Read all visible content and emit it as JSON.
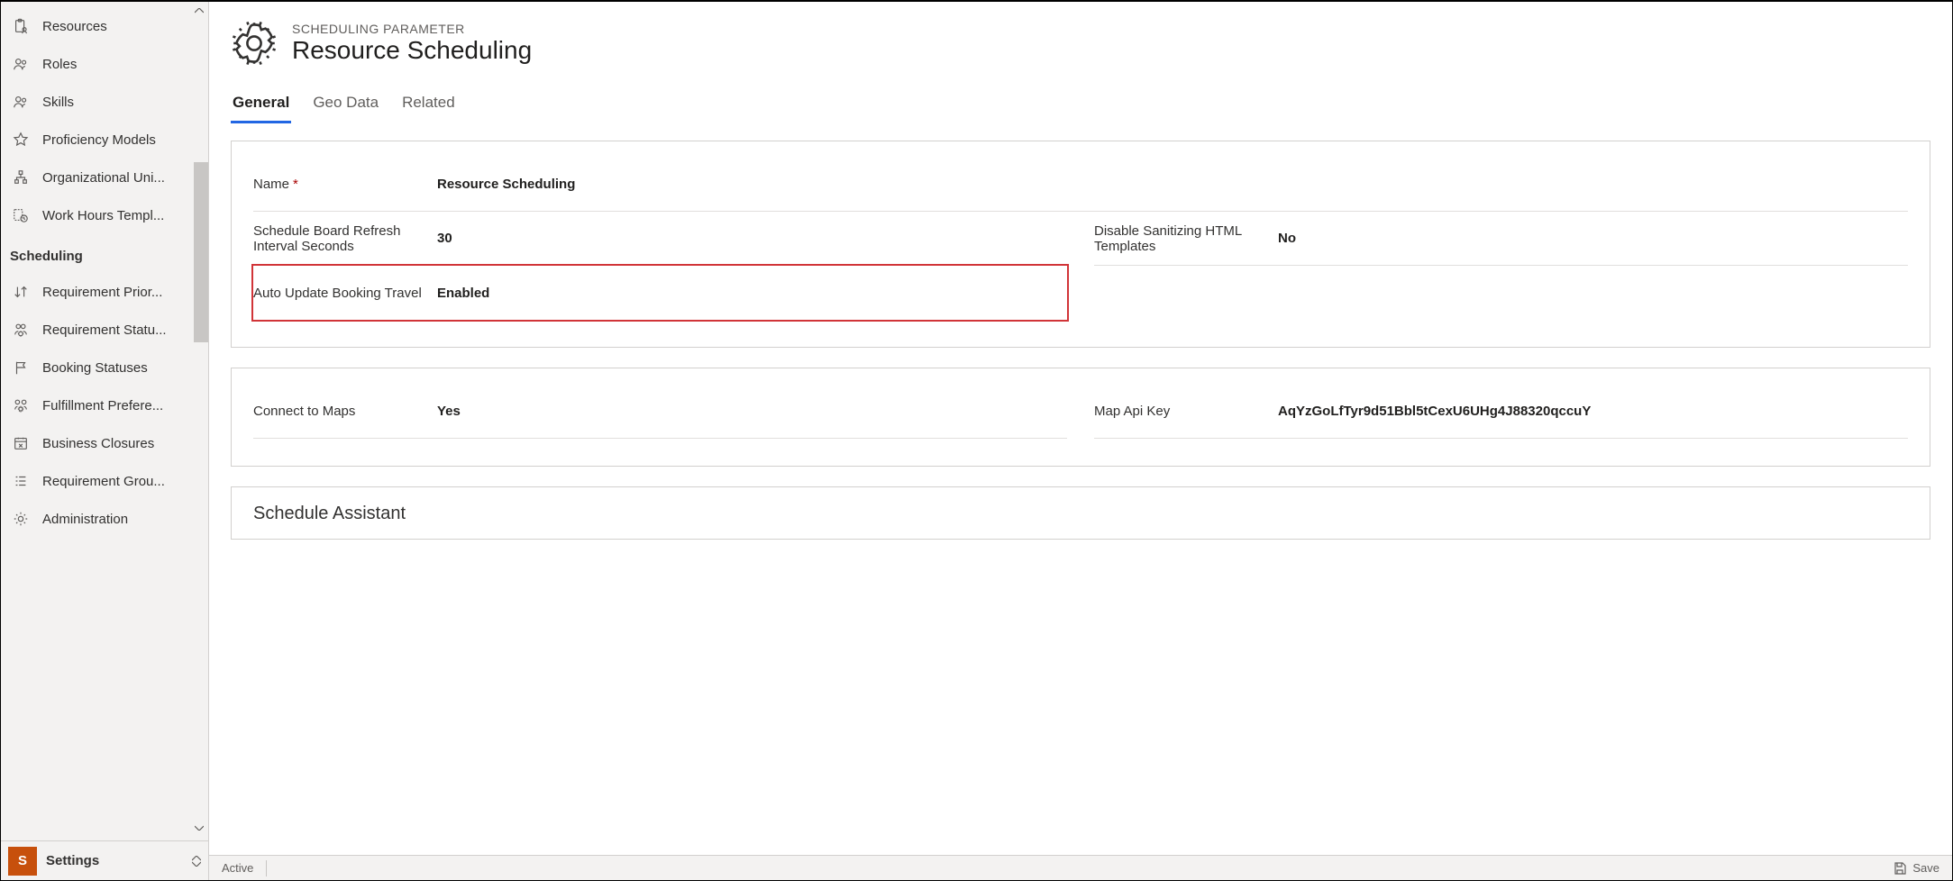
{
  "sidebar": {
    "group1": [
      {
        "icon": "clipboard-person",
        "label": "Resources"
      },
      {
        "icon": "people",
        "label": "Roles"
      },
      {
        "icon": "people",
        "label": "Skills"
      },
      {
        "icon": "star",
        "label": "Proficiency Models"
      },
      {
        "icon": "org",
        "label": "Organizational Uni..."
      },
      {
        "icon": "clock-template",
        "label": "Work Hours Templ..."
      }
    ],
    "section_header": "Scheduling",
    "group2": [
      {
        "icon": "sort",
        "label": "Requirement Prior..."
      },
      {
        "icon": "people-gear",
        "label": "Requirement Statu..."
      },
      {
        "icon": "flag",
        "label": "Booking Statuses"
      },
      {
        "icon": "people-gear",
        "label": "Fulfillment Prefere..."
      },
      {
        "icon": "calendar-x",
        "label": "Business Closures"
      },
      {
        "icon": "list",
        "label": "Requirement Grou..."
      },
      {
        "icon": "gear",
        "label": "Administration"
      }
    ],
    "footer": {
      "letter": "S",
      "label": "Settings"
    }
  },
  "header": {
    "breadcrumb": "SCHEDULING PARAMETER",
    "title": "Resource Scheduling"
  },
  "tabs": [
    {
      "label": "General",
      "active": true
    },
    {
      "label": "Geo Data"
    },
    {
      "label": "Related"
    }
  ],
  "form": {
    "name": {
      "label": "Name",
      "required": true,
      "value": "Resource Scheduling"
    },
    "refresh": {
      "label": "Schedule Board Refresh Interval Seconds",
      "value": "30"
    },
    "disable_sanitize": {
      "label": "Disable Sanitizing HTML Templates",
      "value": "No"
    },
    "auto_update_travel": {
      "label": "Auto Update Booking Travel",
      "value": "Enabled"
    },
    "connect_maps": {
      "label": "Connect to Maps",
      "value": "Yes"
    },
    "map_api_key": {
      "label": "Map Api Key",
      "value": "AqYzGoLfTyr9d51Bbl5tCexU6UHg4J88320qccuY"
    },
    "schedule_assistant_header": "Schedule Assistant"
  },
  "statusbar": {
    "state": "Active",
    "save": "Save"
  }
}
